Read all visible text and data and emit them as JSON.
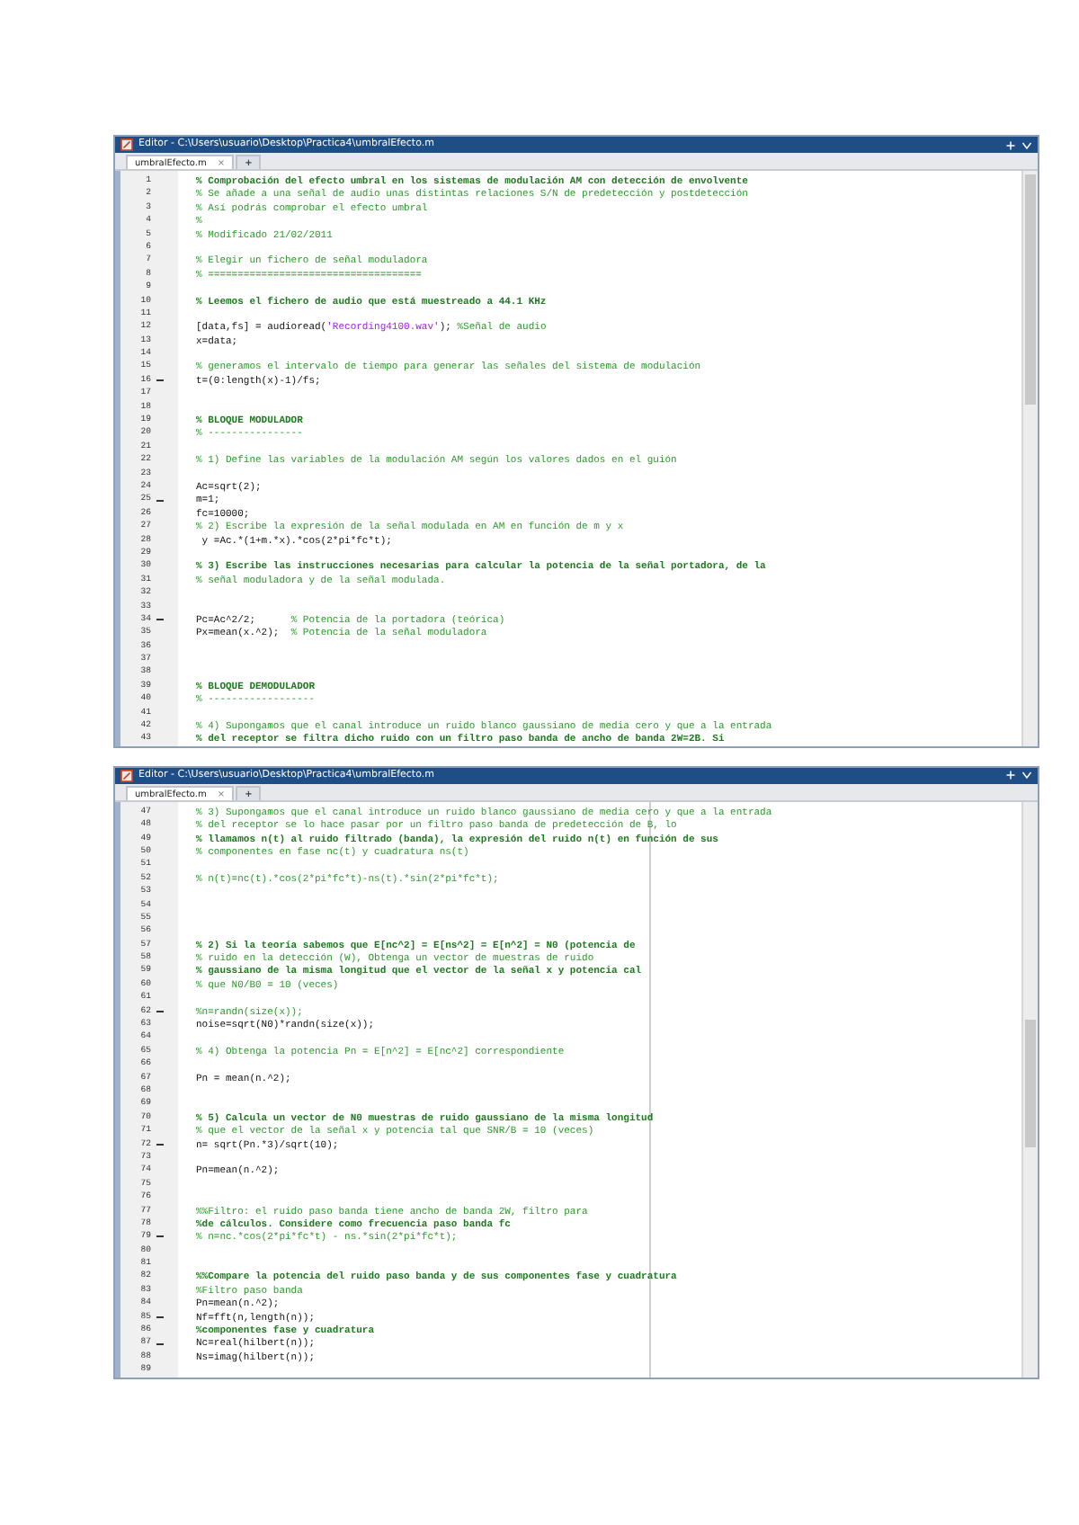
{
  "editors": [
    {
      "title": "Editor - C:\\Users\\usuario\\Desktop\\Practica4\\umbralEfecto.m",
      "tabs": [
        {
          "label": "umbralEfecto.m",
          "close": "×",
          "selected": true
        },
        {
          "label": "+",
          "selected": false
        }
      ],
      "divider": false,
      "lines": [
        {
          "num": "1",
          "exec": false,
          "segments": [
            {
              "kind": "section",
              "text": "% Comprobación del efecto umbral en los sistemas de modulación AM con detección de envolvente"
            }
          ]
        },
        {
          "num": "2",
          "exec": false,
          "segments": [
            {
              "kind": "comment",
              "text": "% Se añade a una señal de audio unas distintas relaciones S/N de predetección y postdetección"
            }
          ]
        },
        {
          "num": "3",
          "exec": false,
          "segments": [
            {
              "kind": "comment",
              "text": "% Así podrás comprobar el efecto umbral"
            }
          ]
        },
        {
          "num": "4",
          "exec": false,
          "segments": [
            {
              "kind": "comment",
              "text": "%"
            }
          ]
        },
        {
          "num": "5",
          "exec": false,
          "segments": [
            {
              "kind": "comment",
              "text": "% Modificado 21/02/2011"
            }
          ]
        },
        {
          "num": "6",
          "exec": false
        },
        {
          "num": "7",
          "exec": false,
          "segments": [
            {
              "kind": "comment",
              "text": "% Elegir un fichero de señal moduladora"
            }
          ]
        },
        {
          "num": "8",
          "exec": false,
          "segments": [
            {
              "kind": "comment",
              "text": "% ===================================="
            }
          ]
        },
        {
          "num": "9",
          "exec": false
        },
        {
          "num": "10",
          "exec": false,
          "segments": [
            {
              "kind": "section",
              "text": "% Leemos el fichero de audio que está muestreado a 44.1 KHz"
            }
          ]
        },
        {
          "num": "11",
          "exec": false
        },
        {
          "num": "12",
          "exec": false,
          "segments": [
            {
              "kind": "code",
              "text": "[data,fs] = audioread("
            },
            {
              "kind": "string",
              "text": "'Recording4100.wav'"
            },
            {
              "kind": "code",
              "text": "); "
            },
            {
              "kind": "comment",
              "text": "%Señal de audio"
            }
          ]
        },
        {
          "num": "13",
          "exec": false,
          "segments": [
            {
              "kind": "code",
              "text": "x=data;"
            }
          ]
        },
        {
          "num": "14",
          "exec": false
        },
        {
          "num": "15",
          "exec": false,
          "segments": [
            {
              "kind": "comment",
              "text": "% generamos el intervalo de tiempo para generar las señales del sistema de modulación"
            }
          ]
        },
        {
          "num": "16",
          "exec": true,
          "segments": [
            {
              "kind": "code",
              "text": "t=(0:length(x)-1)/fs;"
            }
          ]
        },
        {
          "num": "17",
          "exec": false
        },
        {
          "num": "18",
          "exec": false
        },
        {
          "num": "19",
          "exec": false,
          "segments": [
            {
              "kind": "section",
              "text": "% BLOQUE MODULADOR"
            }
          ]
        },
        {
          "num": "20",
          "exec": false,
          "segments": [
            {
              "kind": "comment",
              "text": "% ----------------"
            }
          ]
        },
        {
          "num": "21",
          "exec": false
        },
        {
          "num": "22",
          "exec": false,
          "segments": [
            {
              "kind": "comment",
              "text": "% 1) Define las variables de la modulación AM según los valores dados en el guión"
            }
          ]
        },
        {
          "num": "23",
          "exec": false
        },
        {
          "num": "24",
          "exec": false,
          "segments": [
            {
              "kind": "code",
              "text": "Ac=sqrt(2);"
            }
          ]
        },
        {
          "num": "25",
          "exec": true,
          "segments": [
            {
              "kind": "code",
              "text": "m=1;"
            }
          ]
        },
        {
          "num": "26",
          "exec": false,
          "segments": [
            {
              "kind": "code",
              "text": "fc=10000;"
            }
          ]
        },
        {
          "num": "27",
          "exec": false,
          "segments": [
            {
              "kind": "comment",
              "text": "% 2) Escribe la expresión de la señal modulada en AM en función de m y x"
            }
          ]
        },
        {
          "num": "28",
          "exec": false,
          "segments": [
            {
              "kind": "code",
              "text": " y =Ac.*(1+m.*x).*cos(2*pi*fc*t);"
            }
          ]
        },
        {
          "num": "29",
          "exec": false
        },
        {
          "num": "30",
          "exec": false,
          "segments": [
            {
              "kind": "section",
              "text": "% 3) Escribe las instrucciones necesarias para calcular la potencia de la señal portadora, de la"
            }
          ]
        },
        {
          "num": "31",
          "exec": false,
          "segments": [
            {
              "kind": "comment",
              "text": "% señal moduladora y de la señal modulada."
            }
          ]
        },
        {
          "num": "32",
          "exec": false
        },
        {
          "num": "33",
          "exec": false
        },
        {
          "num": "34",
          "exec": true,
          "segments": [
            {
              "kind": "code",
              "text": "Pc=Ac^2/2;      "
            },
            {
              "kind": "comment",
              "text": "% Potencia de la portadora (teórica)"
            }
          ]
        },
        {
          "num": "35",
          "exec": false,
          "segments": [
            {
              "kind": "code",
              "text": "Px=mean(x.^2);  "
            },
            {
              "kind": "comment",
              "text": "% Potencia de la señal moduladora"
            }
          ]
        },
        {
          "num": "36",
          "exec": false
        },
        {
          "num": "37",
          "exec": false
        },
        {
          "num": "38",
          "exec": false
        },
        {
          "num": "39",
          "exec": false,
          "segments": [
            {
              "kind": "section",
              "text": "% BLOQUE DEMODULADOR"
            }
          ]
        },
        {
          "num": "40",
          "exec": false,
          "segments": [
            {
              "kind": "comment",
              "text": "% ------------------"
            }
          ]
        },
        {
          "num": "41",
          "exec": false
        },
        {
          "num": "42",
          "exec": false,
          "segments": [
            {
              "kind": "comment",
              "text": "% 4) Supongamos que el canal introduce un ruido blanco gaussiano de media cero y que a la entrada"
            }
          ]
        },
        {
          "num": "43",
          "exec": false,
          "segments": [
            {
              "kind": "section",
              "text": "% del receptor se filtra dicho ruido con un filtro paso banda de ancho de banda 2W=2B. Si"
            }
          ]
        }
      ]
    },
    {
      "title": "Editor - C:\\Users\\usuario\\Desktop\\Practica4\\umbralEfecto.m",
      "tabs": [
        {
          "label": "umbralEfecto.m",
          "close": "×",
          "selected": true
        },
        {
          "label": "+",
          "selected": false
        }
      ],
      "divider": true,
      "lines": [
        {
          "num": "47",
          "exec": false,
          "segments": [
            {
              "kind": "comment",
              "text": "% 3) Supongamos que el canal introduce un ruido blanco gaussiano de media cero y que a la entrada"
            }
          ]
        },
        {
          "num": "48",
          "exec": false,
          "segments": [
            {
              "kind": "comment",
              "text": "% del receptor se lo hace pasar por un filtro paso banda de predetección de B, lo"
            }
          ]
        },
        {
          "num": "49",
          "exec": false,
          "segments": [
            {
              "kind": "section",
              "text": "% llamamos n(t) al ruido filtrado (banda), la expresión del ruido n(t) en función de sus"
            }
          ]
        },
        {
          "num": "50",
          "exec": false,
          "segments": [
            {
              "kind": "comment",
              "text": "% componentes en fase nc(t) y cuadratura ns(t)"
            }
          ]
        },
        {
          "num": "51",
          "exec": false
        },
        {
          "num": "52",
          "exec": false,
          "segments": [
            {
              "kind": "comment",
              "text": "% n(t)=nc(t).*cos(2*pi*fc*t)-ns(t).*sin(2*pi*fc*t);"
            }
          ]
        },
        {
          "num": "53",
          "exec": false
        },
        {
          "num": "54",
          "exec": false
        },
        {
          "num": "55",
          "exec": false
        },
        {
          "num": "56",
          "exec": false
        },
        {
          "num": "57",
          "exec": false,
          "segments": [
            {
              "kind": "section",
              "text": "% 2) Si la teoría sabemos que E[nc^2] = E[ns^2] = E[n^2] = N0 (potencia de"
            }
          ]
        },
        {
          "num": "58",
          "exec": false,
          "segments": [
            {
              "kind": "comment",
              "text": "% ruido en la detección (W), Obtenga un vector de muestras de ruido"
            }
          ]
        },
        {
          "num": "59",
          "exec": false,
          "segments": [
            {
              "kind": "section",
              "text": "% gaussiano de la misma longitud que el vector de la señal x y potencia cal"
            }
          ]
        },
        {
          "num": "60",
          "exec": false,
          "segments": [
            {
              "kind": "comment",
              "text": "% que N0/B0 = 10 (veces)"
            }
          ]
        },
        {
          "num": "61",
          "exec": false
        },
        {
          "num": "62",
          "exec": true,
          "segments": [
            {
              "kind": "comment",
              "text": "%n=randn(size(x));"
            }
          ]
        },
        {
          "num": "63",
          "exec": false,
          "segments": [
            {
              "kind": "code",
              "text": "noise=sqrt(N0)*randn(size(x));"
            }
          ]
        },
        {
          "num": "64",
          "exec": false
        },
        {
          "num": "65",
          "exec": false,
          "segments": [
            {
              "kind": "comment",
              "text": "% 4) Obtenga la potencia Pn = E[n^2] = E[nc^2] correspondiente"
            }
          ]
        },
        {
          "num": "66",
          "exec": false
        },
        {
          "num": "67",
          "exec": false,
          "segments": [
            {
              "kind": "code",
              "text": "Pn = mean(n.^2);"
            }
          ]
        },
        {
          "num": "68",
          "exec": false
        },
        {
          "num": "69",
          "exec": false
        },
        {
          "num": "70",
          "exec": false,
          "segments": [
            {
              "kind": "section",
              "text": "% 5) Calcula un vector de N0 muestras de ruido gaussiano de la misma longitud"
            }
          ]
        },
        {
          "num": "71",
          "exec": false,
          "segments": [
            {
              "kind": "comment",
              "text": "% que el vector de la señal x y potencia tal que SNR/B = 10 (veces)"
            }
          ]
        },
        {
          "num": "72",
          "exec": true,
          "segments": [
            {
              "kind": "code",
              "text": "n= sqrt(Pn.*3)/sqrt(10);"
            }
          ]
        },
        {
          "num": "73",
          "exec": false
        },
        {
          "num": "74",
          "exec": false,
          "segments": [
            {
              "kind": "code",
              "text": "Pn=mean(n.^2);"
            }
          ]
        },
        {
          "num": "75",
          "exec": false
        },
        {
          "num": "76",
          "exec": false
        },
        {
          "num": "77",
          "exec": false,
          "segments": [
            {
              "kind": "comment",
              "text": "%%Filtro: el ruido paso banda tiene ancho de banda 2W, filtro para"
            }
          ]
        },
        {
          "num": "78",
          "exec": false,
          "segments": [
            {
              "kind": "section",
              "text": "%de cálculos. Considere como frecuencia paso banda fc"
            }
          ]
        },
        {
          "num": "79",
          "exec": true,
          "segments": [
            {
              "kind": "comment",
              "text": "% n=nc.*cos(2*pi*fc*t) - ns.*sin(2*pi*fc*t);"
            }
          ]
        },
        {
          "num": "80",
          "exec": false
        },
        {
          "num": "81",
          "exec": false
        },
        {
          "num": "82",
          "exec": false,
          "segments": [
            {
              "kind": "section",
              "text": "%%Compare la potencia del ruido paso banda y de sus componentes fase y cuadratura"
            }
          ]
        },
        {
          "num": "83",
          "exec": false,
          "segments": [
            {
              "kind": "comment",
              "text": "%Filtro paso banda"
            }
          ]
        },
        {
          "num": "84",
          "exec": false,
          "segments": [
            {
              "kind": "code",
              "text": "Pn=mean(n.^2);"
            }
          ]
        },
        {
          "num": "85",
          "exec": true,
          "segments": [
            {
              "kind": "code",
              "text": "Nf=fft(n,length(n));"
            }
          ]
        },
        {
          "num": "86",
          "exec": false,
          "segments": [
            {
              "kind": "section",
              "text": "%componentes fase y cuadratura"
            }
          ]
        },
        {
          "num": "87",
          "exec": true,
          "segments": [
            {
              "kind": "code",
              "text": "Nc=real(hilbert(n));"
            }
          ]
        },
        {
          "num": "88",
          "exec": false,
          "segments": [
            {
              "kind": "code",
              "text": "Ns=imag(hilbert(n));"
            }
          ]
        },
        {
          "num": "89",
          "exec": false
        }
      ]
    }
  ]
}
